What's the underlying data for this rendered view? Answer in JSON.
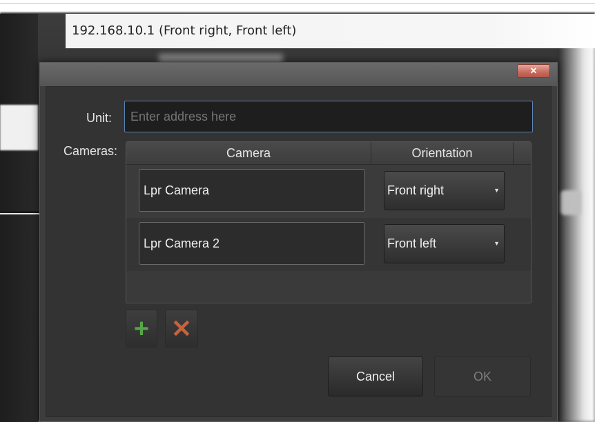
{
  "background": {
    "header_text": "192.168.10.1 (Front right, Front left)"
  },
  "dialog": {
    "close_icon": "close-icon",
    "unit": {
      "label": "Unit:",
      "placeholder": "Enter address here",
      "value": ""
    },
    "cameras": {
      "label": "Cameras:",
      "columns": [
        "Camera",
        "Orientation"
      ],
      "rows": [
        {
          "camera": "Lpr Camera",
          "orientation": "Front right"
        },
        {
          "camera": "Lpr Camera 2",
          "orientation": "Front left"
        }
      ]
    },
    "add_icon": "plus-icon",
    "remove_icon": "x-icon",
    "cancel_label": "Cancel",
    "ok_label": "OK",
    "colors": {
      "add_icon": "#56a74a",
      "remove_icon": "#c9623a",
      "input_border": "#5d84b4",
      "close_button": "#c86a5d"
    }
  }
}
